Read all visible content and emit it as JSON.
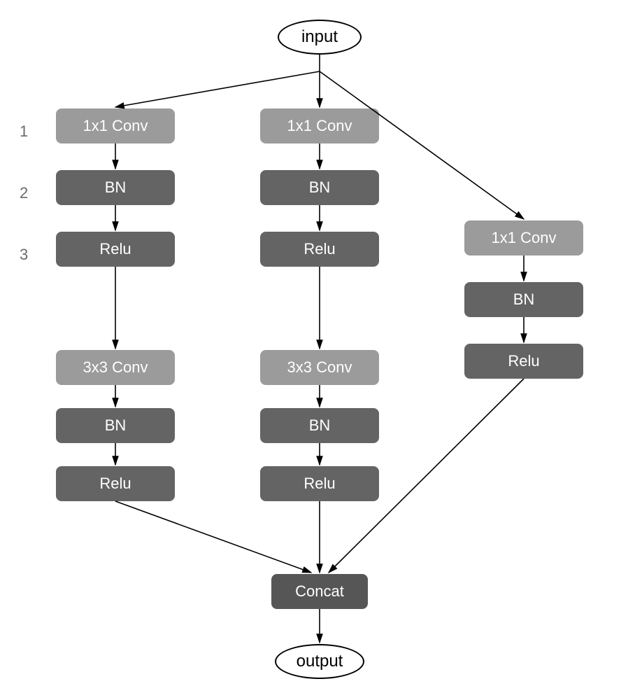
{
  "nodes": {
    "input": "input",
    "output": "output",
    "concat": "Concat"
  },
  "rowLabels": [
    "1",
    "2",
    "3"
  ],
  "branch1": [
    {
      "type": "conv",
      "label": "1x1 Conv"
    },
    {
      "type": "bn",
      "label": "BN"
    },
    {
      "type": "relu",
      "label": "Relu"
    },
    {
      "type": "conv",
      "label": "3x3 Conv"
    },
    {
      "type": "bn",
      "label": "BN"
    },
    {
      "type": "relu",
      "label": "Relu"
    }
  ],
  "branch2": [
    {
      "type": "conv",
      "label": "1x1 Conv"
    },
    {
      "type": "bn",
      "label": "BN"
    },
    {
      "type": "relu",
      "label": "Relu"
    },
    {
      "type": "conv",
      "label": "3x3 Conv"
    },
    {
      "type": "bn",
      "label": "BN"
    },
    {
      "type": "relu",
      "label": "Relu"
    }
  ],
  "branch3": [
    {
      "type": "conv",
      "label": "1x1 Conv"
    },
    {
      "type": "bn",
      "label": "BN"
    },
    {
      "type": "relu",
      "label": "Relu"
    }
  ]
}
